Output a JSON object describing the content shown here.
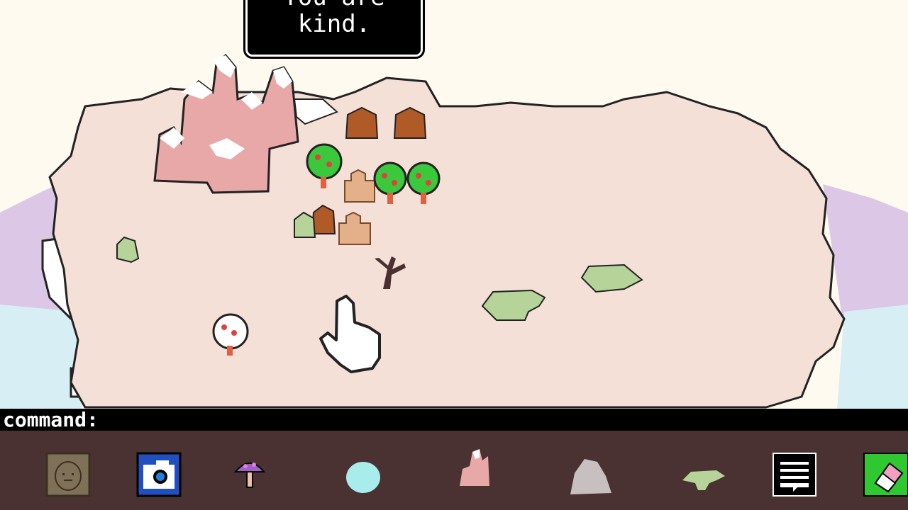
{
  "speech_bubble": {
    "line1": "You are",
    "line2": "kind."
  },
  "command_bar": {
    "label": "command:"
  },
  "toolbar": {
    "tools": [
      {
        "name": "creature-face-tool"
      },
      {
        "name": "camera-tool"
      },
      {
        "name": "mushroom-tool"
      },
      {
        "name": "water-drop-tool"
      },
      {
        "name": "mountain-tool"
      },
      {
        "name": "rock-tool"
      },
      {
        "name": "lizard-tool"
      },
      {
        "name": "speech-tool"
      },
      {
        "name": "eraser-tool"
      }
    ]
  },
  "colors": {
    "land": "#f5e0d8",
    "sea_lavender": "#dcc8e6",
    "sea_blue": "#d6eef4",
    "mountain": "#e8a8a8",
    "tree_green": "#3cc83c",
    "hut": "#b05a28",
    "creature": "#b6d49a",
    "toolbar_bg": "#4a3232"
  }
}
